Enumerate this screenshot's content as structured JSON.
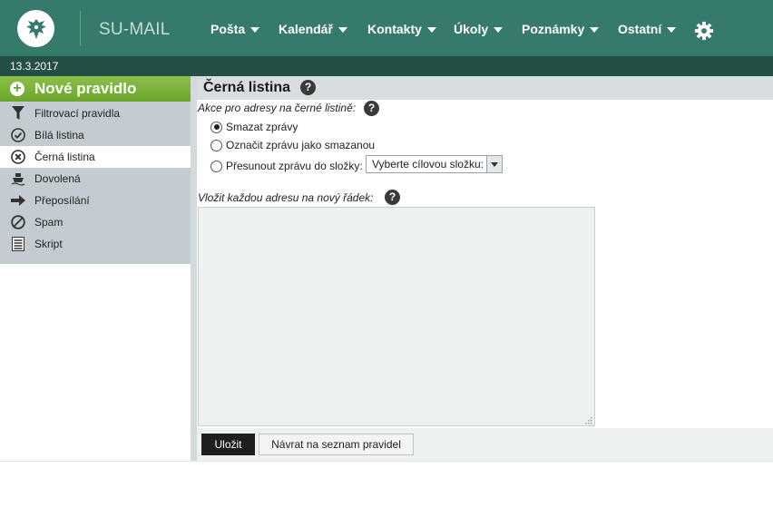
{
  "header": {
    "app_title": "SU-MAIL",
    "nav": [
      {
        "label": "Pošta"
      },
      {
        "label": "Kalendář"
      },
      {
        "label": "Kontakty"
      },
      {
        "label": "Úkoly"
      },
      {
        "label": "Poznámky"
      },
      {
        "label": "Ostatní"
      }
    ],
    "settings_icon": "gear-icon",
    "logo_icon": "eagle-emblem-icon",
    "colors": {
      "header_bg": "#357a6b",
      "date_bar_bg": "#244f46",
      "accent_green": "#6aa52c"
    }
  },
  "date_bar": {
    "date": "13.3.2017"
  },
  "sidebar": {
    "new_rule_label": "Nové pravidlo",
    "items": [
      {
        "label": "Filtrovací pravidla",
        "icon": "funnel-icon",
        "active": false
      },
      {
        "label": "Bílá listina",
        "icon": "check-circle-icon",
        "active": false
      },
      {
        "label": "Černá listina",
        "icon": "x-circle-icon",
        "active": true
      },
      {
        "label": "Dovolená",
        "icon": "ship-icon",
        "active": false
      },
      {
        "label": "Přeposílání",
        "icon": "arrow-right-icon",
        "active": false
      },
      {
        "label": "Spam",
        "icon": "no-entry-icon",
        "active": false
      },
      {
        "label": "Skript",
        "icon": "script-icon",
        "active": false
      }
    ]
  },
  "main": {
    "title": "Černá listina",
    "action_label": "Akce pro adresy na černé listině:",
    "options": [
      {
        "label": "Smazat zprávy",
        "checked": true
      },
      {
        "label": "Označit zprávu jako smazanou",
        "checked": false
      },
      {
        "label": "Přesunout zprávu do složky:",
        "checked": false
      }
    ],
    "folder_select_value": "Vyberte cílovou složku:",
    "addresses_label": "Vložit každou adresu na nový řádek:",
    "addresses_value": "",
    "save_label": "Uložit",
    "back_label": "Návrat na seznam pravidel"
  }
}
